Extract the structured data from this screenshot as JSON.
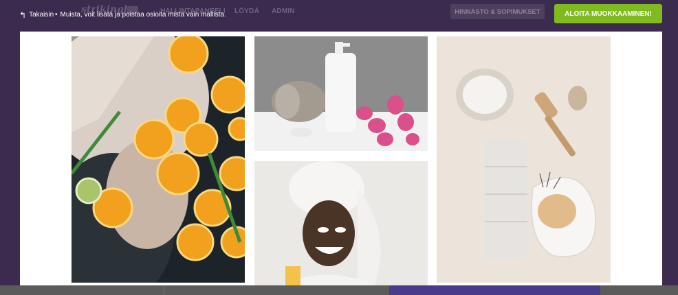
{
  "topbar": {
    "logo": "strikingly",
    "nav": [
      "HALLINTAPANEELI",
      "LÖYDÄ",
      "ADMIN"
    ],
    "back_label": "Takaisin",
    "notice": "Muista, voit lisätä ja poistaa osioita mistä vain mallista.",
    "pricing_label": "HINNASTO & SOPIMUKSET",
    "cta_label": "ALOITA MUOKKAAMINEN!"
  },
  "gallery": {
    "images": [
      {
        "name": "woman-bath-oranges"
      },
      {
        "name": "towel-bottle-tulips"
      },
      {
        "name": "woman-face-mask"
      },
      {
        "name": "spa-salt-brush-towel"
      }
    ]
  },
  "colors": {
    "topbar": "#3b2b4e",
    "cta": "#7fba1e",
    "modal": "#ffffff"
  }
}
